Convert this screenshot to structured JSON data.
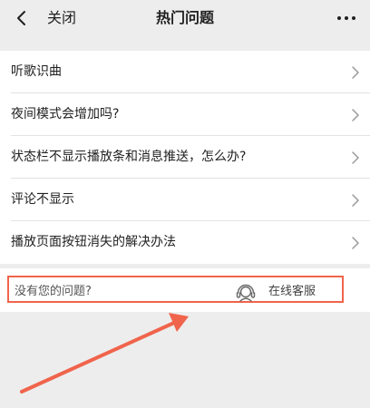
{
  "header": {
    "back_icon": "chevron-left-icon",
    "close_label": "关闭",
    "title": "热门问题",
    "more_icon": "more-dots-icon"
  },
  "questions": [
    {
      "label": "听歌识曲"
    },
    {
      "label": "夜间模式会增加吗?"
    },
    {
      "label": "状态栏不显示播放条和消息推送，怎么办?"
    },
    {
      "label": "评论不显示"
    },
    {
      "label": "播放页面按钮消失的解决办法"
    }
  ],
  "help": {
    "question": "没有您的问题?",
    "service_icon": "headset-agent-icon",
    "service_label": "在线客服"
  },
  "colors": {
    "page_background": "#ededed",
    "panel_background": "#ffffff",
    "annotation_red": "#f0644c"
  }
}
